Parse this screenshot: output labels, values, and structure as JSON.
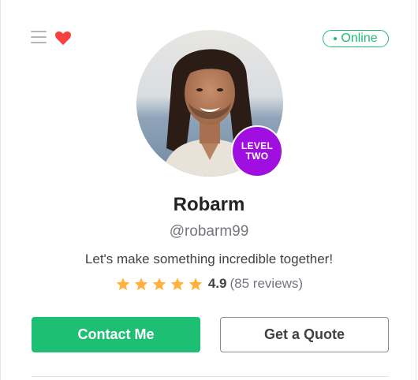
{
  "status": {
    "label": "Online",
    "color": "#1dbf73"
  },
  "header": {
    "menu_icon": "hamburger-icon",
    "favorite_icon": "heart-icon"
  },
  "seller": {
    "avatar_icon": "profile-photo",
    "level_line1": "LEVEL",
    "level_line2": "TWO",
    "level_color": "#a10fe0",
    "name": "Robarm",
    "handle": "@robarm99",
    "tagline": "Let's make something incredible together!"
  },
  "rating": {
    "stars": 5,
    "score": "4.9",
    "reviews": "(85 reviews)",
    "star_color": "#ffb33e"
  },
  "actions": {
    "contact_label": "Contact Me",
    "quote_label": "Get a Quote",
    "accent": "#1dbf73"
  }
}
